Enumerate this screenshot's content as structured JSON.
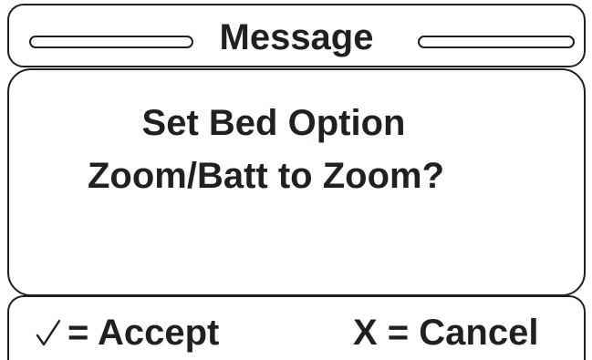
{
  "header": {
    "title": "Message"
  },
  "message": {
    "line1": "Set Bed Option",
    "line2": "Zoom/Batt to Zoom?"
  },
  "footer": {
    "accept_label": "= Accept",
    "cancel_label": "X = Cancel",
    "accept_icon": "check-icon"
  },
  "colors": {
    "ink": "#231f20",
    "background": "#ffffff"
  }
}
